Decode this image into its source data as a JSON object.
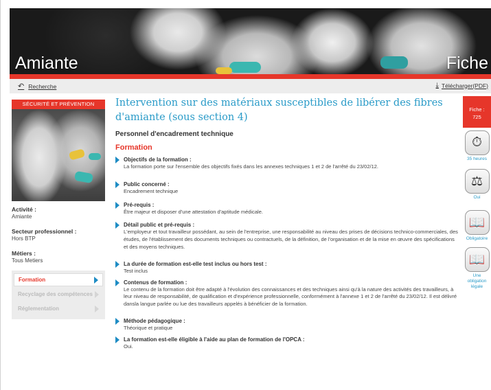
{
  "hero": {
    "title": "Amiante",
    "right_text": "Fiche"
  },
  "toolbar": {
    "back_label": "Recherche",
    "download_label": "Télécharger(PDF)"
  },
  "sidebar": {
    "header": "SÉCURITÉ ET PRÉVENTION",
    "fields": [
      {
        "label": "Activité :",
        "value": "Amiante"
      },
      {
        "label": "Secteur professionnel :",
        "value": "Hors BTP"
      },
      {
        "label": "Métiers :",
        "value": "Tous Metiers"
      }
    ],
    "nav": [
      {
        "label": "Formation",
        "active": true
      },
      {
        "label": "Recyclage des compétences",
        "active": false
      },
      {
        "label": "Réglementation",
        "active": false
      }
    ]
  },
  "main": {
    "title": "Intervention sur des matériaux susceptibles de libérer des fibres d'amiante (sous section 4)",
    "subtitle": "Personnel d'encadrement technique",
    "section": "Formation",
    "items": [
      {
        "label": "Objectifs de la formation :",
        "text": "La formation porte sur l'ensemble des objectifs fixés dans les annexes techniques 1 et 2 de l'arrêté du 23/02/12."
      },
      {
        "label": "Public concerné :",
        "text": "Encadrement technique"
      },
      {
        "label": "Pré-requis :",
        "text": "Être majeur et disposer d'une attestation d'aptitude médicale."
      },
      {
        "label": "Détail public et pré-requis :",
        "text": "L'employeur et tout travailleur possédant, au sein de l'entreprise, une responsabilité au niveau des prises de décisions technico-commerciales, des études, de l'établissement des documents techniques ou contractuels, de la définition, de l'organisation et de la mise en œuvre des spécifications et des moyens techniques."
      },
      {
        "label": "La durée de formation est-elle test inclus ou hors test :",
        "text": "Test inclus"
      },
      {
        "label": "Contenus de formation :",
        "text": "Le contenu de la formation doit être adapté à l'évolution des connaissances et des techniques ainsi qu'à la nature des activités des travailleurs, à leur niveau de responsabilité, de qualification et d'expérience professionnelle, conformément à l'annexe 1 et 2 de l'arrêté du 23/02/12. Il est délivré dansla langue parlée ou lue des travailleurs appelés à bénéficier de la formation."
      },
      {
        "label": "Méthode pédagogique :",
        "text": "Théorique et pratique"
      },
      {
        "label": "La formation est-elle éligible à l'aide au plan de formation de l'OPCA :",
        "text": "Oui."
      }
    ]
  },
  "rail": {
    "fiche_label": "Fiche :",
    "fiche_number": "725",
    "icons": [
      {
        "icon": "stopwatch-icon",
        "glyph": "⏱",
        "caption": "35 heures"
      },
      {
        "icon": "scales-icon",
        "glyph": "⚖",
        "caption": "Oui"
      },
      {
        "icon": "book-icon",
        "glyph": "📖",
        "caption": "Obligatoire"
      },
      {
        "icon": "book-seal-icon",
        "glyph": "📖",
        "caption": "Une obligation légale"
      }
    ]
  },
  "colors": {
    "accent_red": "#e6362a",
    "accent_blue": "#2a9bc8",
    "marker_blue": "#1e8cc4"
  }
}
